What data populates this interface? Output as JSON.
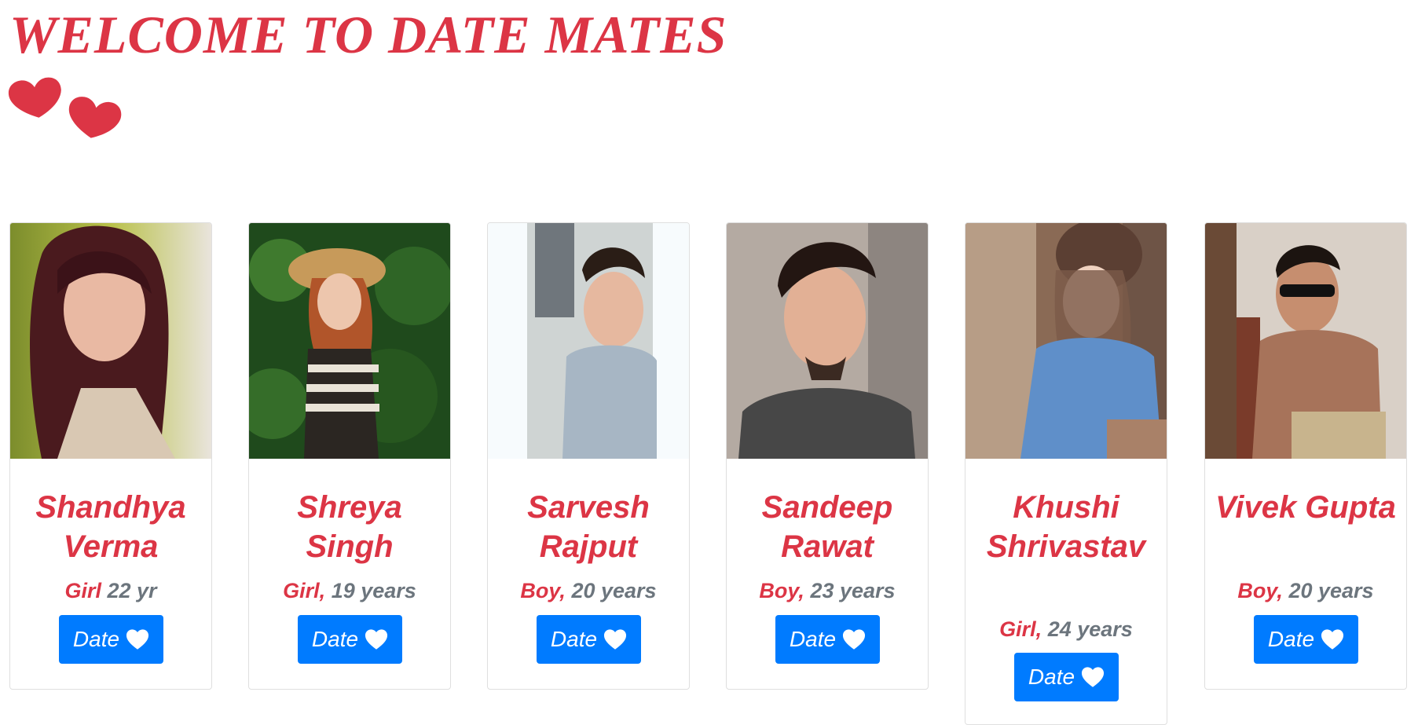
{
  "header": {
    "title": "WELCOME TO DATE MATES",
    "logo_icon": "two-hearts-icon",
    "accent_color": "#dc3545"
  },
  "profiles": [
    {
      "name": "Shandhya Verma",
      "gender": "Girl",
      "age": "22 yr",
      "button_label": "Date",
      "button_icon": "heart-icon"
    },
    {
      "name": "Shreya Singh",
      "gender": "Girl,",
      "age": "19 years",
      "button_label": "Date",
      "button_icon": "heart-icon"
    },
    {
      "name": "Sarvesh Rajput",
      "gender": "Boy,",
      "age": "20 years",
      "button_label": "Date",
      "button_icon": "heart-icon"
    },
    {
      "name": "Sandeep Rawat",
      "gender": "Boy,",
      "age": "23 years",
      "button_label": "Date",
      "button_icon": "heart-icon"
    },
    {
      "name": "Khushi Shrivastav",
      "gender": "Girl,",
      "age": "24 years",
      "button_label": "Date",
      "button_icon": "heart-icon"
    },
    {
      "name": "Vivek Gupta",
      "gender": "Boy,",
      "age": "20 years",
      "button_label": "Date",
      "button_icon": "heart-icon"
    }
  ],
  "colors": {
    "button": "#007bff",
    "name": "#dc3545",
    "age": "#6c757d"
  }
}
